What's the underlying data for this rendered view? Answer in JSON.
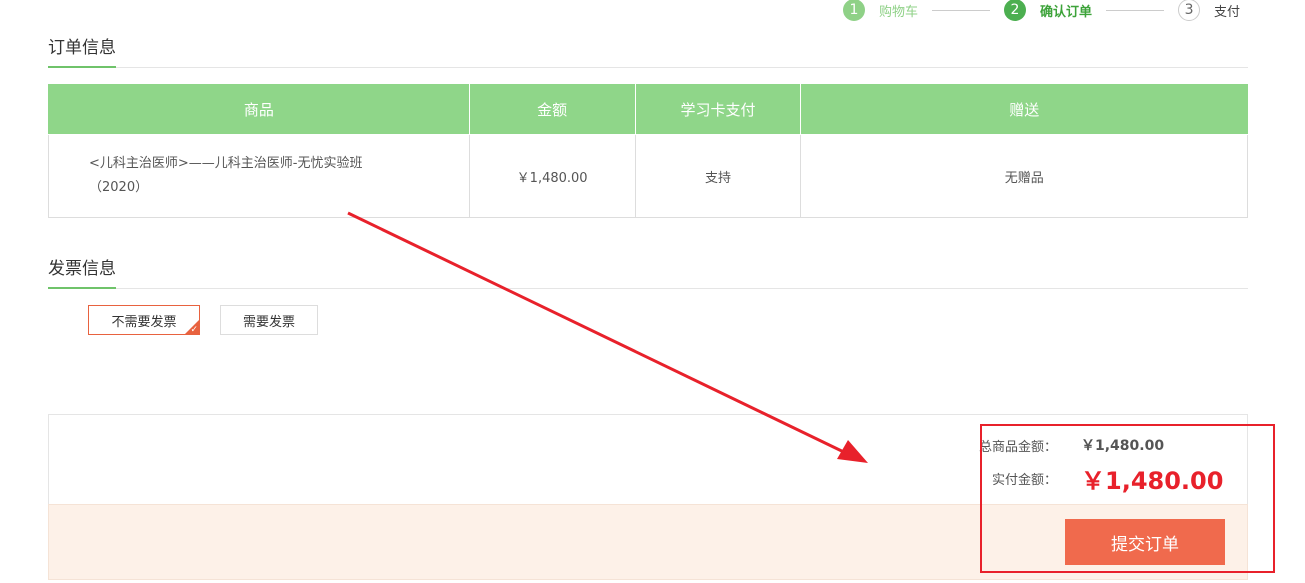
{
  "steps": [
    {
      "num": "1",
      "label": "购物车",
      "state": "done"
    },
    {
      "num": "2",
      "label": "确认订单",
      "state": "active"
    },
    {
      "num": "3",
      "label": "支付",
      "state": "todo"
    }
  ],
  "order_section": {
    "title": "订单信息",
    "headers": [
      "商品",
      "金额",
      "学习卡支付",
      "赠送"
    ],
    "row": {
      "product_line1": "<儿科主治医师>——儿科主治医师-无忧实验班",
      "product_line2": "（2020）",
      "amount": "￥1,480.00",
      "card_pay": "支持",
      "gift": "无赠品"
    }
  },
  "invoice_section": {
    "title": "发票信息",
    "options": [
      "不需要发票",
      "需要发票"
    ],
    "selected": "不需要发票"
  },
  "summary": {
    "total_label": "总商品金额：",
    "total_value": "￥1,480.00",
    "paid_label": "实付金额：",
    "paid_value": "￥1,480.00"
  },
  "submit_label": "提交订单",
  "colors": {
    "header_green": "#8fd689",
    "accent_orange": "#f06a4d",
    "price_red": "#e8212b",
    "annotation_red": "#e8212b"
  }
}
